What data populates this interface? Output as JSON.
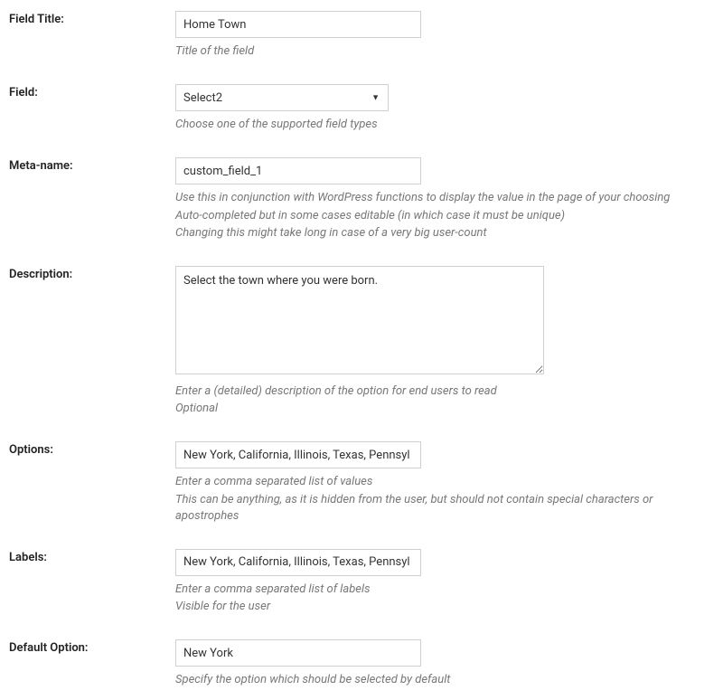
{
  "fieldTitle": {
    "label": "Field Title:",
    "value": "Home Town",
    "help1": "Title of the field"
  },
  "field": {
    "label": "Field:",
    "value": "Select2",
    "help1": "Choose one of the supported field types"
  },
  "metaName": {
    "label": "Meta-name:",
    "value": "custom_field_1",
    "help1": "Use this in conjunction with WordPress functions to display the value in the page of your choosing",
    "help2": "Auto-completed but in some cases editable (in which case it must be unique)",
    "help3": "Changing this might take long in case of a very big user-count"
  },
  "description": {
    "label": "Description:",
    "value": "Select the town where you were born.",
    "help1": "Enter a (detailed) description of the option for end users to read",
    "help2": "Optional"
  },
  "options": {
    "label": "Options:",
    "value": "New York, California, Illinois, Texas, Pennsyl",
    "help1": "Enter a comma separated list of values",
    "help2": "This can be anything, as it is hidden from the user, but should not contain special characters or apostrophes"
  },
  "labels": {
    "label": "Labels:",
    "value": "New York, California, Illinois, Texas, Pennsyl",
    "help1": "Enter a comma separated list of labels",
    "help2": "Visible for the user"
  },
  "defaultOption": {
    "label": "Default Option:",
    "value": "New York",
    "help1": "Specify the option which should be selected by default"
  }
}
